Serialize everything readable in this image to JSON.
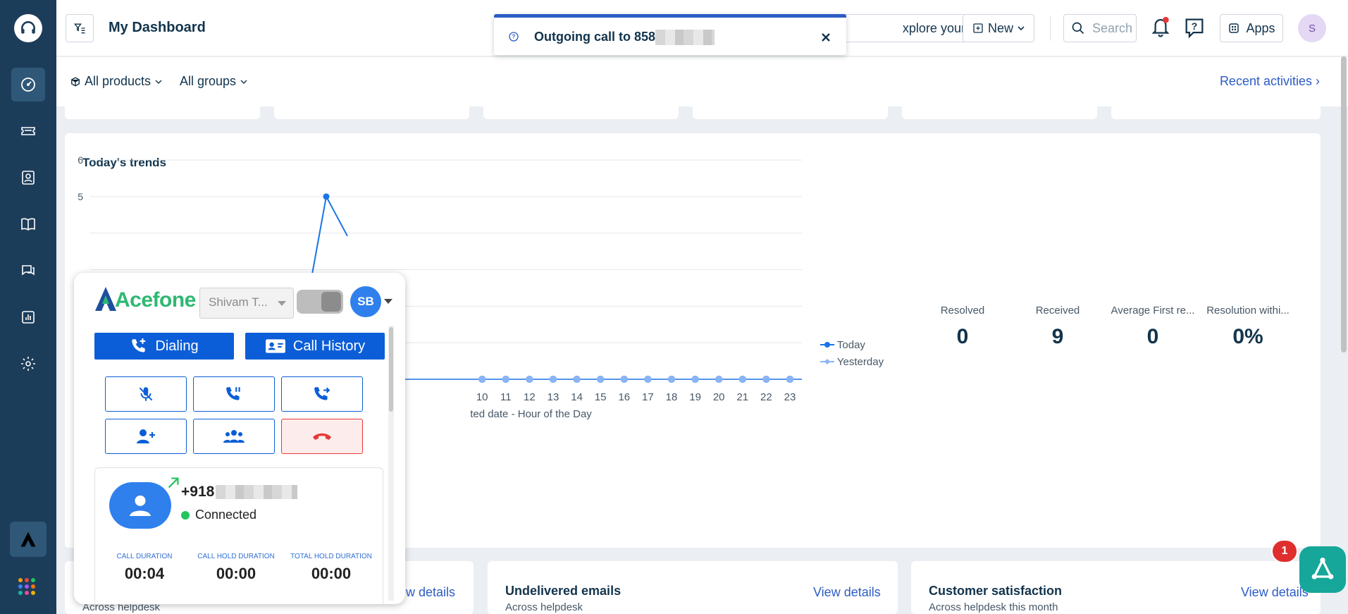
{
  "header": {
    "title": "My Dashboard",
    "explore_label": "xplore your plan",
    "new_label": "New",
    "search_placeholder": "Search",
    "apps_label": "Apps",
    "user_initial": "S"
  },
  "toast": {
    "text": "Outgoing call to 858"
  },
  "filters": {
    "products": "All products",
    "groups": "All groups",
    "recent": "Recent activities"
  },
  "trends": {
    "title": "Today's trends",
    "legend": [
      "Today",
      "Yesterday"
    ],
    "stats": [
      {
        "label": "Resolved",
        "value": "0"
      },
      {
        "label": "Received",
        "value": "9"
      },
      {
        "label": "Average First re...",
        "value": "0"
      },
      {
        "label": "Resolution withi...",
        "value": "0%"
      }
    ]
  },
  "chart_data": {
    "type": "line",
    "title": "Today's trends",
    "xlabel": "...ted date - Hour of the Day",
    "ylabel": "",
    "y_ticks": [
      5,
      6
    ],
    "x": [
      10,
      11,
      12,
      13,
      14,
      15,
      16,
      17,
      18,
      19,
      20,
      21,
      22,
      23
    ],
    "series": [
      {
        "name": "Today",
        "values": [
          0,
          0,
          0,
          0,
          0,
          0,
          0,
          0,
          0,
          0,
          0,
          0,
          0,
          0
        ]
      },
      {
        "name": "Yesterday",
        "values": [
          0,
          0,
          0,
          0,
          0,
          0,
          0,
          0,
          0,
          0,
          0,
          0,
          0,
          0
        ]
      }
    ],
    "visible_peak": {
      "series": "Today",
      "value": 5
    },
    "ylim": [
      0,
      6
    ],
    "grid": true,
    "legend_position": "right"
  },
  "bottom_cards": [
    {
      "title": "",
      "sub": "Across helpdesk",
      "link": "iew details"
    },
    {
      "title": "Undelivered emails",
      "sub": "Across helpdesk",
      "link": "View details"
    },
    {
      "title": "Customer satisfaction",
      "sub": "Across helpdesk this month",
      "link": "View details"
    }
  ],
  "widget": {
    "brand": "Acefone",
    "agent": "Shivam T...",
    "avatar": "SB",
    "dialing_label": "Dialing",
    "history_label": "Call History",
    "number": "+918",
    "status": "Connected",
    "durations": [
      {
        "label": "CALL DURATION",
        "value": "00:04"
      },
      {
        "label": "CALL HOLD DURATION",
        "value": "00:00"
      },
      {
        "label": "TOTAL HOLD DURATION",
        "value": "00:00"
      }
    ]
  },
  "fab_badge": "1",
  "colors": {
    "sidebar": "#1c3d5a",
    "accent": "#2c5cc5",
    "widget_blue": "#0b5ed7",
    "series_today": "#1a73e8",
    "series_yesterday": "#8ab4f8",
    "connected": "#22c55e",
    "fab": "#16a79a"
  }
}
